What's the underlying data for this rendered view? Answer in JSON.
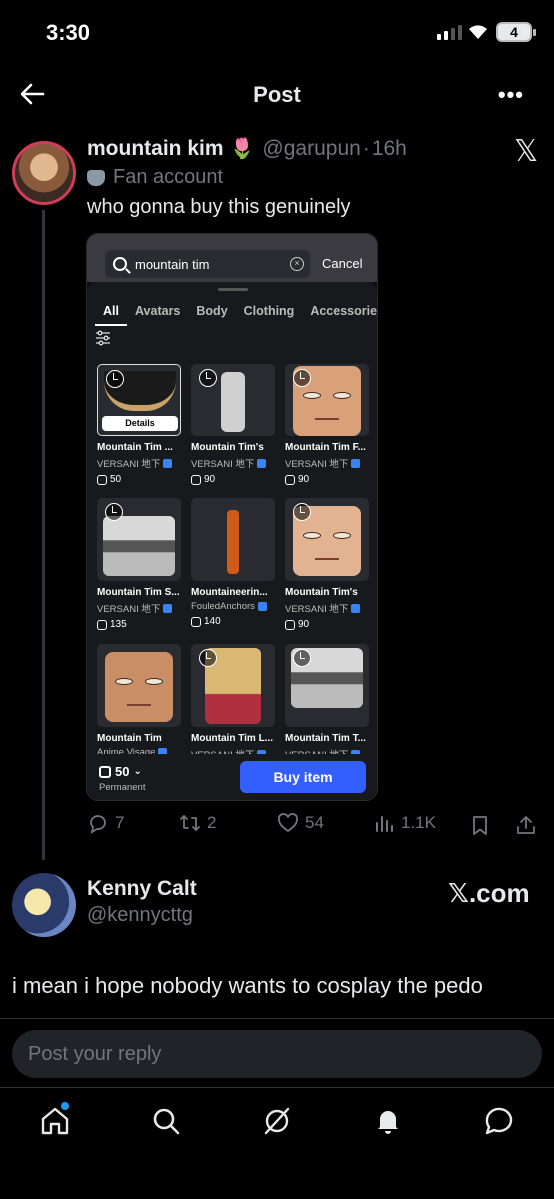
{
  "status_bar": {
    "time": "3:30",
    "battery": "4"
  },
  "header": {
    "title": "Post"
  },
  "post": {
    "author_name": "mountain kim",
    "author_emoji": "🌷",
    "author_handle": "@garupun",
    "separator": "·",
    "age": "16h",
    "badge_label": "Fan account",
    "text": "who gonna buy this genuinely",
    "stats": {
      "replies": "7",
      "reposts": "2",
      "likes": "54",
      "views": "1.1K"
    }
  },
  "embedded": {
    "search_value": "mountain tim",
    "cancel_label": "Cancel",
    "tabs": [
      "All",
      "Avatars",
      "Body",
      "Clothing",
      "Accessories"
    ],
    "items": [
      {
        "name": "Mountain Tim ...",
        "creator": "VERSANI 地下",
        "price": "50",
        "details": "Details"
      },
      {
        "name": "Mountain Tim's",
        "creator": "VERSANI 地下",
        "price": "90"
      },
      {
        "name": "Mountain Tim F...",
        "creator": "VERSANI 地下",
        "price": "90"
      },
      {
        "name": "Mountain Tim S...",
        "creator": "VERSANI 地下",
        "price": "135"
      },
      {
        "name": "Mountaineerin...",
        "creator": "FouledAnchors",
        "price": "140"
      },
      {
        "name": "Mountain Tim's",
        "creator": "VERSANI 地下",
        "price": "90"
      },
      {
        "name": "Mountain Tim",
        "creator": "Anime Visage",
        "price": ""
      },
      {
        "name": "Mountain Tim L...",
        "creator": "VERSANI 地下",
        "price": ""
      },
      {
        "name": "Mountain Tim T...",
        "creator": "VERSANI 地下",
        "price": ""
      }
    ],
    "selected_price": "50",
    "permanent_label": "Permanent",
    "buy_label": "Buy item"
  },
  "reply": {
    "author_name": "Kenny Calt",
    "author_handle": "@kennycttg",
    "watermark": "𝕏.com",
    "text": "i mean i hope nobody wants to cosplay the pedo"
  },
  "composer": {
    "placeholder": "Post your reply"
  },
  "colors": {
    "accent": "#1d9bf0",
    "buy_button": "#335fff",
    "avatar_ring": "#d23b5a"
  }
}
